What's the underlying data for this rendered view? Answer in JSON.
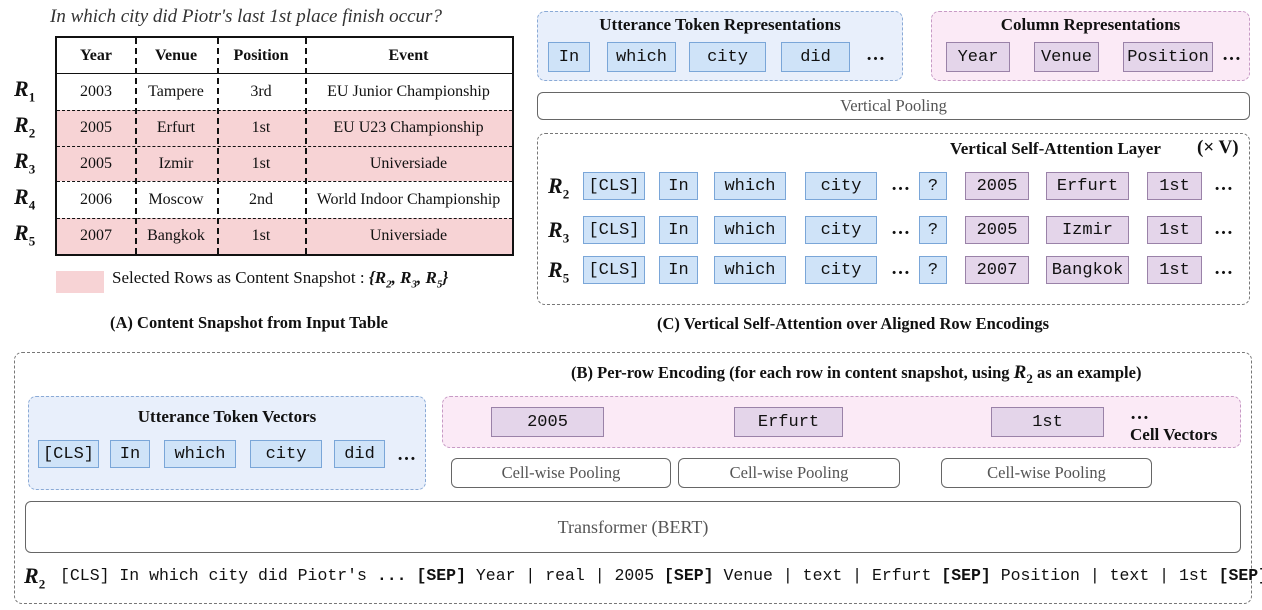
{
  "question": "In which city did Piotr's last 1st place finish occur?",
  "table": {
    "headers": [
      "Year",
      "Venue",
      "Position",
      "Event"
    ],
    "rows": [
      {
        "label": "R",
        "sub": "1",
        "year": "2003",
        "venue": "Tampere",
        "position": "3rd",
        "event": "EU Junior Championship",
        "selected": false
      },
      {
        "label": "R",
        "sub": "2",
        "year": "2005",
        "venue": "Erfurt",
        "position": "1st",
        "event": "EU U23 Championship",
        "selected": true
      },
      {
        "label": "R",
        "sub": "3",
        "year": "2005",
        "venue": "Izmir",
        "position": "1st",
        "event": "Universiade",
        "selected": true
      },
      {
        "label": "R",
        "sub": "4",
        "year": "2006",
        "venue": "Moscow",
        "position": "2nd",
        "event": "World Indoor Championship",
        "selected": false
      },
      {
        "label": "R",
        "sub": "5",
        "year": "2007",
        "venue": "Bangkok",
        "position": "1st",
        "event": "Universiade",
        "selected": true
      }
    ]
  },
  "legend": {
    "text": "Selected Rows as Content Snapshot :",
    "set_open": "{",
    "set_items": [
      {
        "r": "R",
        "sub": "2"
      },
      {
        "r": "R",
        "sub": "3"
      },
      {
        "r": "R",
        "sub": "5"
      }
    ],
    "set_close": "}",
    "swatch_color": "#f7d3d5"
  },
  "captions": {
    "a": "(A) Content Snapshot from Input Table",
    "c": "(C) Vertical Self-Attention over Aligned Row Encodings",
    "b": "(B) Per-row Encoding (for each row in content snapshot, using",
    "b_row": "R",
    "b_row_sub": "2",
    "b_tail": "as an example)"
  },
  "utterance_repr": {
    "title": "Utterance Token Representations",
    "tokens": [
      "In",
      "which",
      "city",
      "did"
    ],
    "ellipsis": "…"
  },
  "column_repr": {
    "title": "Column Representations",
    "tokens": [
      "Year",
      "Venue",
      "Position"
    ],
    "ellipsis": "…"
  },
  "vertical_pooling": "Vertical Pooling",
  "vsa": {
    "title": "Vertical Self-Attention Layer",
    "times": "(× V)",
    "rows": [
      {
        "label": "R",
        "sub": "2",
        "utt": [
          "[CLS]",
          "In",
          "which",
          "city"
        ],
        "q": "?",
        "cells": [
          "2005",
          "Erfurt",
          "1st"
        ]
      },
      {
        "label": "R",
        "sub": "3",
        "utt": [
          "[CLS]",
          "In",
          "which",
          "city"
        ],
        "q": "?",
        "cells": [
          "2005",
          "Izmir",
          "1st"
        ]
      },
      {
        "label": "R",
        "sub": "5",
        "utt": [
          "[CLS]",
          "In",
          "which",
          "city"
        ],
        "q": "?",
        "cells": [
          "2007",
          "Bangkok",
          "1st"
        ]
      }
    ],
    "ellipsis": "…"
  },
  "utterance_vectors": {
    "title": "Utterance Token Vectors",
    "tokens": [
      "[CLS]",
      "In",
      "which",
      "city",
      "did"
    ],
    "ellipsis": "…"
  },
  "cell_vectors": {
    "title": "Cell Vectors",
    "cells": [
      "2005",
      "Erfurt",
      "1st"
    ],
    "ellipsis": "…",
    "pooling": "Cell-wise Pooling"
  },
  "transformer": "Transformer (BERT)",
  "sequence": {
    "label": "R",
    "sub": "2",
    "parts": [
      {
        "t": "[CLS] In which city did Piotr's ",
        "b": false
      },
      {
        "t": "... [SEP]",
        "b": true
      },
      {
        "t": " Year | real | 2005 ",
        "b": false
      },
      {
        "t": "[SEP]",
        "b": true
      },
      {
        "t": " Venue | text | Erfurt ",
        "b": false
      },
      {
        "t": "[SEP]",
        "b": true
      },
      {
        "t": " Position | text | 1st ",
        "b": false
      },
      {
        "t": "[SEP] ...",
        "b": true
      }
    ]
  }
}
